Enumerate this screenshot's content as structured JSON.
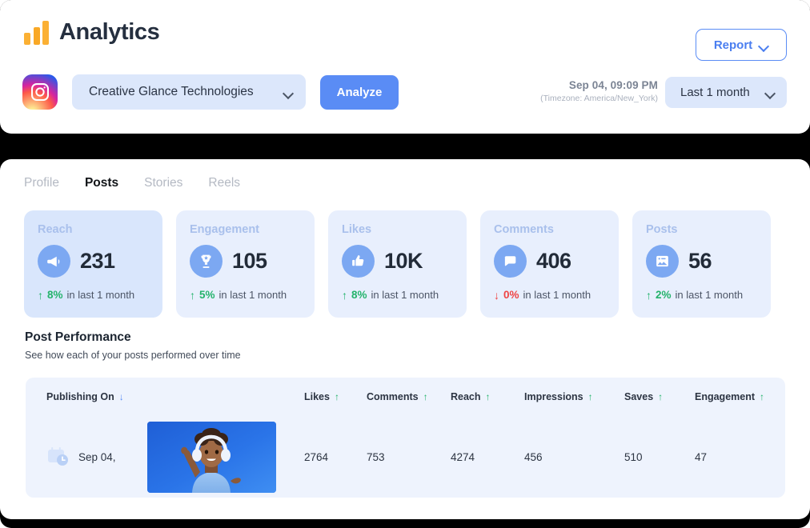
{
  "header": {
    "logo_icon": "bar-chart-icon",
    "title": "Analytics",
    "platform_icon": "instagram-icon",
    "account": {
      "value": "Creative Glance Technologies",
      "chevron_icon": "chevron-down-icon"
    },
    "analyze_label": "Analyze",
    "report": {
      "label": "Report",
      "chevron_icon": "chevron-down-icon"
    },
    "timestamp": "Sep 04, 09:09 PM",
    "timezone": "(Timezone: America/New_York)",
    "range": {
      "value": "Last 1 month",
      "chevron_icon": "chevron-down-icon"
    }
  },
  "tabs": [
    {
      "label": "Profile",
      "active": false
    },
    {
      "label": "Posts",
      "active": true
    },
    {
      "label": "Stories",
      "active": false
    },
    {
      "label": "Reels",
      "active": false
    }
  ],
  "stats": [
    {
      "label": "Reach",
      "value": "231",
      "icon": "megaphone-icon",
      "direction": "up",
      "arrow": "↑",
      "percent": "8%",
      "period": "in last 1 month",
      "highlight": true
    },
    {
      "label": "Engagement",
      "value": "105",
      "icon": "trophy-icon",
      "direction": "up",
      "arrow": "↑",
      "percent": "5%",
      "period": "in last 1 month",
      "highlight": false
    },
    {
      "label": "Likes",
      "value": "10K",
      "icon": "thumbs-up-icon",
      "direction": "up",
      "arrow": "↑",
      "percent": "8%",
      "period": "in last 1 month",
      "highlight": false
    },
    {
      "label": "Comments",
      "value": "406",
      "icon": "comment-bubble-icon",
      "direction": "down",
      "arrow": "↓",
      "percent": "0%",
      "period": "in last 1 month",
      "highlight": false
    },
    {
      "label": "Posts",
      "value": "56",
      "icon": "image-card-icon",
      "direction": "up",
      "arrow": "↑",
      "percent": "2%",
      "period": "in last 1 month",
      "highlight": false
    }
  ],
  "performance": {
    "title": "Post Performance",
    "subtitle": "See how each of your posts performed over time",
    "columns": [
      {
        "label": "Publishing On",
        "sort": "desc",
        "arrow": "↓"
      },
      {
        "label": "",
        "sort": "none",
        "arrow": ""
      },
      {
        "label": "Likes",
        "sort": "asc",
        "arrow": "↑"
      },
      {
        "label": "Comments",
        "sort": "asc",
        "arrow": "↑"
      },
      {
        "label": "Reach",
        "sort": "asc",
        "arrow": "↑"
      },
      {
        "label": "Impressions",
        "sort": "asc",
        "arrow": "↑"
      },
      {
        "label": "Saves",
        "sort": "asc",
        "arrow": "↑"
      },
      {
        "label": "Engagement",
        "sort": "asc",
        "arrow": "↑"
      }
    ],
    "rows": [
      {
        "date_icon": "calendar-clock-icon",
        "date": "Sep 04,",
        "thumbnail": "post-thumbnail-person-headphones",
        "likes": "2764",
        "comments": "753",
        "reach": "4274",
        "impressions": "456",
        "saves": "510",
        "engagement": "47"
      }
    ]
  },
  "colors": {
    "accent_blue": "#5a8cf5",
    "card_blue": "#e8effd",
    "card_blue_active": "#d9e6fc",
    "up_green": "#24b36b",
    "down_red": "#ef4444",
    "logo_orange": "#fbb034"
  }
}
